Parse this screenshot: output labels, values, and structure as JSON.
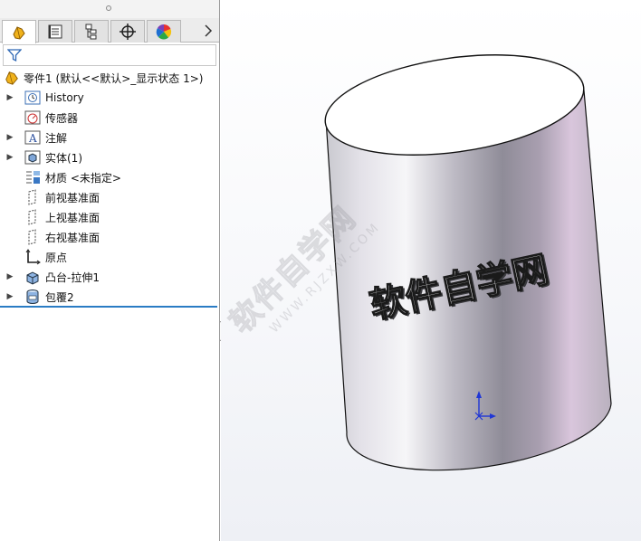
{
  "tabs": [
    {
      "name": "FeatureManager",
      "icon": "feature-manager-icon",
      "active": true
    },
    {
      "name": "PropertyManager",
      "icon": "property-manager-icon",
      "active": false
    },
    {
      "name": "ConfigurationManager",
      "icon": "configuration-manager-icon",
      "active": false
    },
    {
      "name": "DimXpertManager",
      "icon": "dimxpert-icon",
      "active": false
    },
    {
      "name": "DisplayManager",
      "icon": "display-manager-icon",
      "active": false
    }
  ],
  "tree": {
    "root": "零件1  (默认<<默认>_显示状态 1>)",
    "items": [
      {
        "label": "History",
        "icon": "history-icon",
        "expandable": true
      },
      {
        "label": "传感器",
        "icon": "sensor-icon",
        "expandable": false
      },
      {
        "label": "注解",
        "icon": "annotation-icon",
        "expandable": true
      },
      {
        "label": "实体(1)",
        "icon": "solid-bodies-icon",
        "expandable": true
      },
      {
        "label": "材质 <未指定>",
        "icon": "material-icon",
        "expandable": false
      },
      {
        "label": "前视基准面",
        "icon": "plane-icon",
        "expandable": false
      },
      {
        "label": "上视基准面",
        "icon": "plane-icon",
        "expandable": false
      },
      {
        "label": "右视基准面",
        "icon": "plane-icon",
        "expandable": false
      },
      {
        "label": "原点",
        "icon": "origin-icon",
        "expandable": false
      },
      {
        "label": "凸台-拉伸1",
        "icon": "extrude-icon",
        "expandable": true
      },
      {
        "label": "包覆2",
        "icon": "wrap-icon",
        "expandable": true
      }
    ]
  },
  "model": {
    "embossed_text": "软件自学网",
    "watermark_text": "软件自学网",
    "watermark_url": "WWW.RJZXW.COM"
  },
  "colors": {
    "selection_line": "#2a7cc4",
    "cylinder_light": "#f0eef2",
    "cylinder_pink": "#d9c6dc",
    "axis_y": "#1f36d6",
    "axis_x": "#1f36d6"
  }
}
